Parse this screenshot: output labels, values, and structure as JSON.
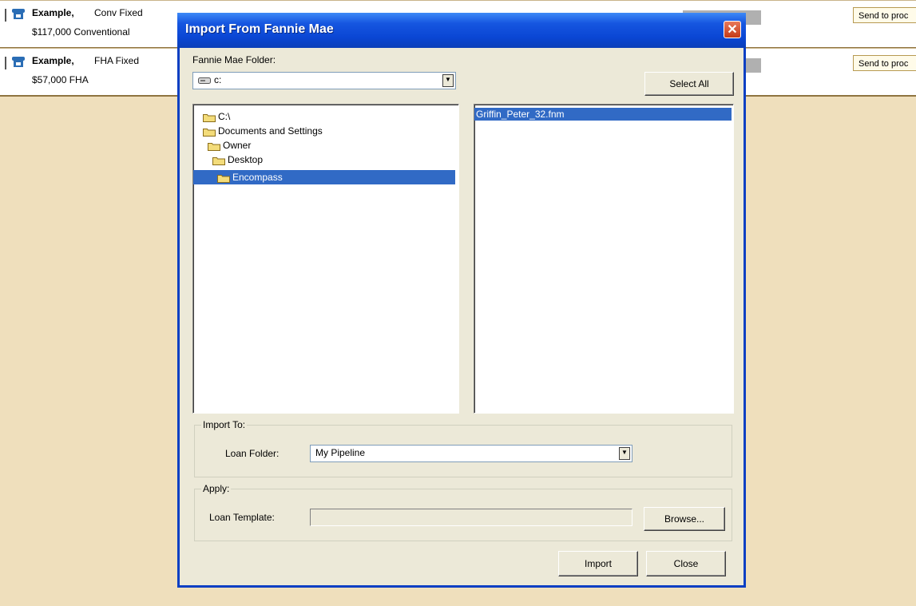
{
  "background": {
    "rows": [
      {
        "name": "Example,",
        "loan_type": "Conv Fixed",
        "amount": "$117,000 Conventional",
        "send_label": "Send to proc"
      },
      {
        "name": "Example,",
        "loan_type": "FHA Fixed",
        "amount": "$57,000 FHA",
        "send_label": "Send to proc"
      }
    ]
  },
  "dialog": {
    "title": "Import From Fannie Mae",
    "close_glyph": "✕",
    "folder_label": "Fannie Mae Folder:",
    "drive_value": "c:",
    "select_all_label": "Select All",
    "tree": [
      {
        "label": "C:\\",
        "selected": false
      },
      {
        "label": "Documents and Settings",
        "selected": false
      },
      {
        "label": "Owner",
        "selected": false
      },
      {
        "label": "Desktop",
        "selected": false
      },
      {
        "label": "Encompass",
        "selected": true
      }
    ],
    "files": [
      {
        "label": "Griffin_Peter_32.fnm",
        "selected": true
      }
    ],
    "import_to": {
      "group_title": "Import To:",
      "loan_folder_label": "Loan Folder:",
      "loan_folder_value": "My Pipeline"
    },
    "apply": {
      "group_title": "Apply:",
      "loan_template_label": "Loan Template:",
      "loan_template_value": "",
      "browse_label": "Browse..."
    },
    "import_label": "Import",
    "close_label": "Close"
  },
  "icons": {
    "phone": "phone-icon",
    "folder": "folder-icon",
    "drive": "drive-icon",
    "dropdown": "chevron-down-icon",
    "close": "close-icon"
  },
  "colors": {
    "titlebar": "#0a46d4",
    "selection": "#316ac5",
    "dialog_face": "#ece9d8",
    "background": "#efdfbc"
  }
}
